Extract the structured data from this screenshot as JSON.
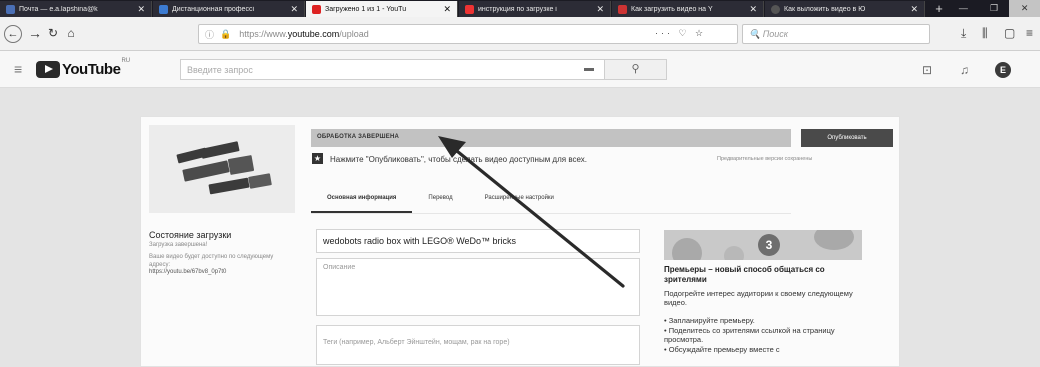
{
  "browser": {
    "tabs": [
      {
        "label": "Почта — e.a.lapshina@k",
        "fav_color": "#4a6fb5",
        "active": false
      },
      {
        "label": "Дистанционная профессі",
        "fav_color": "#3c7bd1",
        "active": false
      },
      {
        "label": "Загружено 1 из 1 - YouTu",
        "fav_color": "#d22",
        "active": true
      },
      {
        "label": "инструкция по загрузке і",
        "fav_color": "#e33",
        "active": false
      },
      {
        "label": "Как загрузить видео на Y",
        "fav_color": "#c33",
        "active": false
      },
      {
        "label": "Как выложить видео в Ю",
        "fav_color": "#555",
        "active": false
      }
    ],
    "new_tab": "+",
    "url_scheme": "https://www.",
    "url_host": "youtube.com",
    "url_path": "/upload",
    "url_actions": "··· ♡ ☆",
    "search_placeholder": "Поиск"
  },
  "header": {
    "logo": "YouTube",
    "logo_region": "RU",
    "search_placeholder": "Введите запрос"
  },
  "upload": {
    "status_title": "Состояние загрузки",
    "status_sub": "Загрузка завершена!",
    "status_note": "Ваше видео будет доступно по следующему адресу:",
    "status_link": "https://youtu.be/67bv8_0p7t0",
    "progress_label": "ОБРАБОТКА ЗАВЕРШЕНА",
    "progress_fraction": 1.0,
    "publish_button": "Опубликовать",
    "publish_hint": "Нажмите \"Опубликовать\", чтобы сделать видео доступным для всех.",
    "saved_note": "Предварительные версии сохранены",
    "tabs": [
      "Основная информация",
      "Перевод",
      "Расширенные настройки"
    ],
    "title_value": "wedobots radio box with LEGO® WeDo™ bricks",
    "description_placeholder": "Описание",
    "tags_placeholder": "Теги (например, Альберт Эйнштейн, мощам, рак на горе)"
  },
  "promo": {
    "badge": "3",
    "title": "Премьеры – новый способ общаться со зрителями",
    "subtitle": "Подогрейте интерес аудитории к своему следующему видео.",
    "items": [
      "Запланируйте премьеру.",
      "Поделитесь со зрителями ссылкой на страницу просмотра.",
      "Обсуждайте премьеру вместе с"
    ]
  }
}
